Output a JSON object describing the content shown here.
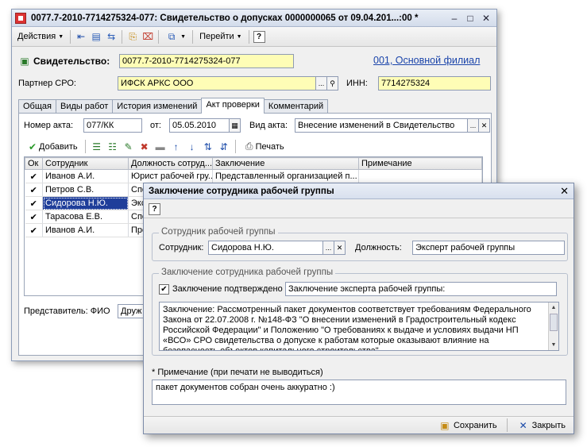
{
  "main_window": {
    "title": "0077.7-2010-7714275324-077: Свидетельство о допусках 0000000065 от 09.04.201...:00 *",
    "controls": {
      "minimize": "–",
      "maximize": "□",
      "close": "✕"
    },
    "toolbar": {
      "actions_label": "Действия",
      "goto_label": "Перейти",
      "help_label": "?"
    },
    "header": {
      "doc_label": "Свидетельство:",
      "doc_value": "0077.7-2010-7714275324-077",
      "branch_link": "001, Основной филиал",
      "partner_label": "Партнер СРО:",
      "partner_value": "ИФСК АРКС ООО",
      "partner_btn": "...",
      "inn_label": "ИНН:",
      "inn_value": "7714275324"
    },
    "tabs": [
      {
        "label": "Общая"
      },
      {
        "label": "Виды работ"
      },
      {
        "label": "История изменений"
      },
      {
        "label": "Акт проверки"
      },
      {
        "label": "Комментарий"
      }
    ],
    "act": {
      "number_label": "Номер акта:",
      "number_value": "077/КК",
      "from_label": "от:",
      "date_value": "05.05.2010",
      "type_label": "Вид акта:",
      "type_value": "Внесение изменений в Свидетельство",
      "type_btn": "..."
    },
    "grid_toolbar": {
      "add_label": "Добавить",
      "print_label": "Печать"
    },
    "table": {
      "columns": [
        "Ок",
        "Сотрудник",
        "Должность сотруд...",
        "Заключение",
        "Примечание"
      ],
      "rows": [
        {
          "ok": "✔",
          "employee": "Иванов А.И.",
          "position": "Юрист рабочей гру...",
          "conclusion": "Представленный организацией п...",
          "note": ""
        },
        {
          "ok": "✔",
          "employee": "Петров С.В.",
          "position": "Спе",
          "conclusion": "",
          "note": ""
        },
        {
          "ok": "✔",
          "employee": "Сидорова Н.Ю.",
          "position": "Экс",
          "conclusion": "",
          "note": ""
        },
        {
          "ok": "✔",
          "employee": "Тарасова Е.В.",
          "position": "Спе",
          "conclusion": "",
          "note": ""
        },
        {
          "ok": "✔",
          "employee": "Иванов А.И.",
          "position": "Пре",
          "conclusion": "",
          "note": ""
        }
      ]
    },
    "representative": {
      "label": "Представитель: ФИО",
      "value": "Друж"
    }
  },
  "dialog": {
    "title": "Заключение сотрудника рабочей группы",
    "close": "✕",
    "help": "?",
    "group1": {
      "title": "Сотрудник рабочей группы",
      "employee_label": "Сотрудник:",
      "employee_value": "Сидорова Н.Ю.",
      "employee_btn": "...",
      "position_label": "Должность:",
      "position_value": "Эксперт рабочей группы"
    },
    "group2": {
      "title": "Заключение сотрудника рабочей группы",
      "confirmed_label": "Заключение подтверждено",
      "confirmed_value": "Заключение эксперта рабочей группы:",
      "conclusion_text": "Заключение: Рассмотренный пакет документов соответствует требованиям Федерального Закона от 22.07.2008 г. №148-ФЗ \"О внесении изменений в Градостроительный кодекс Российской Федерации\" и Положению \"О требованиях к выдаче и условиях выдачи НП «ВСО» СРО свидетельства о допуске к работам которые оказывают влияние на безопасность объектов капитального строительства\""
    },
    "note_label": "* Примечание (при печати не выводиться)",
    "note_value": "пакет документов собран очень аккуратно :)",
    "save_label": "Сохранить",
    "close_label": "Закрыть"
  },
  "colors": {
    "field_yellow": "#fefdb6",
    "selection": "#1f3e9a",
    "link": "#1a44aa"
  }
}
